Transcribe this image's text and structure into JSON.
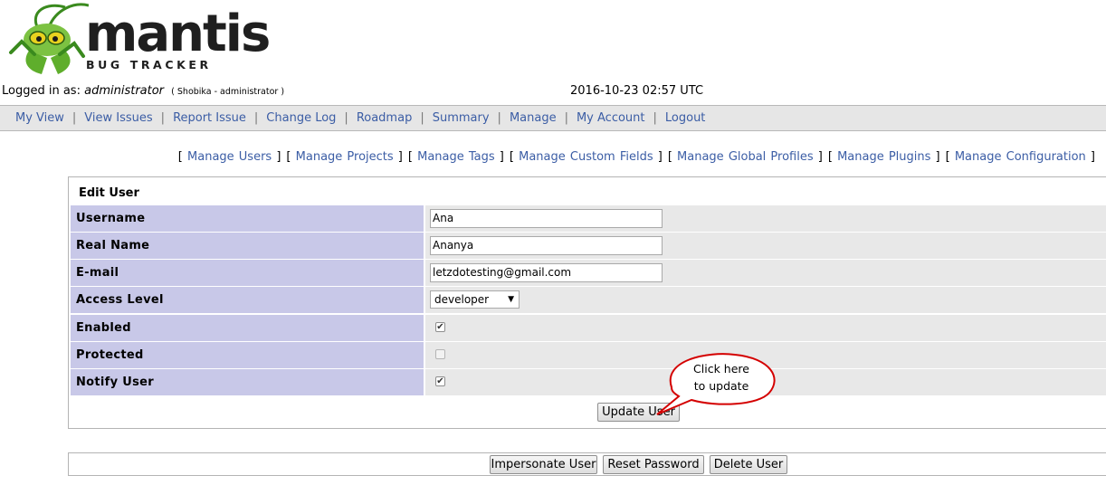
{
  "logo": {
    "word": "mantis",
    "subtitle": "BUG TRACKER"
  },
  "login": {
    "prefix": "Logged in as:",
    "username": "administrator",
    "detail": "( Shobika - administrator )",
    "datetime": "2016-10-23 02:57 UTC"
  },
  "menu": {
    "items": [
      "My View",
      "View Issues",
      "Report Issue",
      "Change Log",
      "Roadmap",
      "Summary",
      "Manage",
      "My Account",
      "Logout"
    ]
  },
  "manage_menu": {
    "items": [
      "Manage Users",
      "Manage Projects",
      "Manage Tags",
      "Manage Custom Fields",
      "Manage Global Profiles",
      "Manage Plugins",
      "Manage Configuration"
    ]
  },
  "form": {
    "title": "Edit User",
    "username_label": "Username",
    "username_value": "Ana",
    "realname_label": "Real Name",
    "realname_value": "Ananya",
    "email_label": "E-mail",
    "email_value": "letzdotesting@gmail.com",
    "access_label": "Access Level",
    "access_value": "developer",
    "enabled_label": "Enabled",
    "enabled_checked": true,
    "protected_label": "Protected",
    "protected_checked": false,
    "notify_label": "Notify User",
    "notify_checked": true,
    "update_button": "Update User"
  },
  "callout": {
    "line1": "Click here",
    "line2": "to update",
    "color": "#d40000"
  },
  "actions": {
    "impersonate_button": "Impersonate User",
    "reset_button": "Reset Password",
    "delete_button": "Delete User"
  },
  "colors": {
    "label_bg": "#c8c8e8",
    "value_bg": "#e8e8e8",
    "link": "#3b5da5",
    "menu_bg": "#e6e6e6"
  }
}
